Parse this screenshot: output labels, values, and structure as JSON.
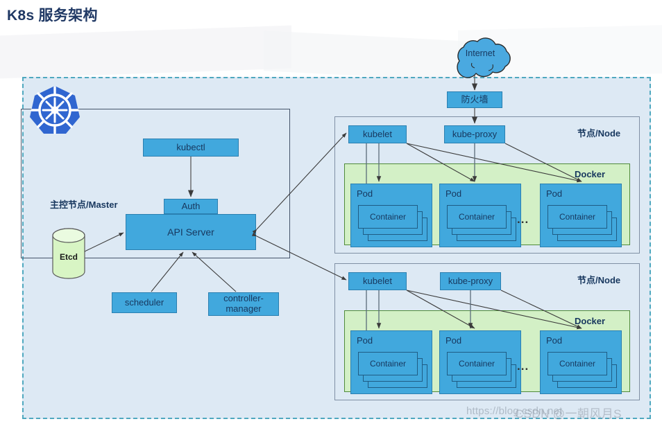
{
  "page": {
    "title": "K8s 服务架构",
    "watermark_url": "https://blog.csdn.net",
    "watermark_user": "CSDN @一朝风月S"
  },
  "colors": {
    "blue_box": "#41a8dd",
    "blue_border": "#2a7fb0",
    "cluster_bg": "#dde9f4",
    "cluster_border": "#4fa8bf",
    "docker_green": "#d3f0c6",
    "docker_border": "#4f8a3a",
    "etcd_green": "#d8f5c4",
    "k8s_logo_blue": "#3066d0",
    "text_navy": "#17375e",
    "title_navy": "#1f3864"
  },
  "icons": {
    "kubernetes_logo": "kubernetes-logo-icon",
    "internet_cloud": "cloud-icon",
    "etcd_cylinder": "database-cylinder-icon"
  },
  "external": {
    "internet_label": "Internet",
    "firewall_label": "防火墙"
  },
  "master": {
    "panel_label": "主控节点/Master",
    "kubectl_label": "kubectl",
    "auth_label": "Auth",
    "api_server_label": "API Server",
    "etcd_label": "Etcd",
    "scheduler_label": "scheduler",
    "controller_manager_label": "controller-\nmanager"
  },
  "nodes": [
    {
      "panel_label": "节点/Node",
      "kubelet_label": "kubelet",
      "kube_proxy_label": "kube-proxy",
      "docker_label": "Docker",
      "ellipsis": "...",
      "pods": [
        {
          "label": "Pod",
          "container_label": "Container"
        },
        {
          "label": "Pod",
          "container_label": "Container"
        },
        {
          "label": "Pod",
          "container_label": "Container"
        }
      ]
    },
    {
      "panel_label": "节点/Node",
      "kubelet_label": "kubelet",
      "kube_proxy_label": "kube-proxy",
      "docker_label": "Docker",
      "ellipsis": "...",
      "pods": [
        {
          "label": "Pod",
          "container_label": "Container"
        },
        {
          "label": "Pod",
          "container_label": "Container"
        },
        {
          "label": "Pod",
          "container_label": "Container"
        }
      ]
    }
  ]
}
